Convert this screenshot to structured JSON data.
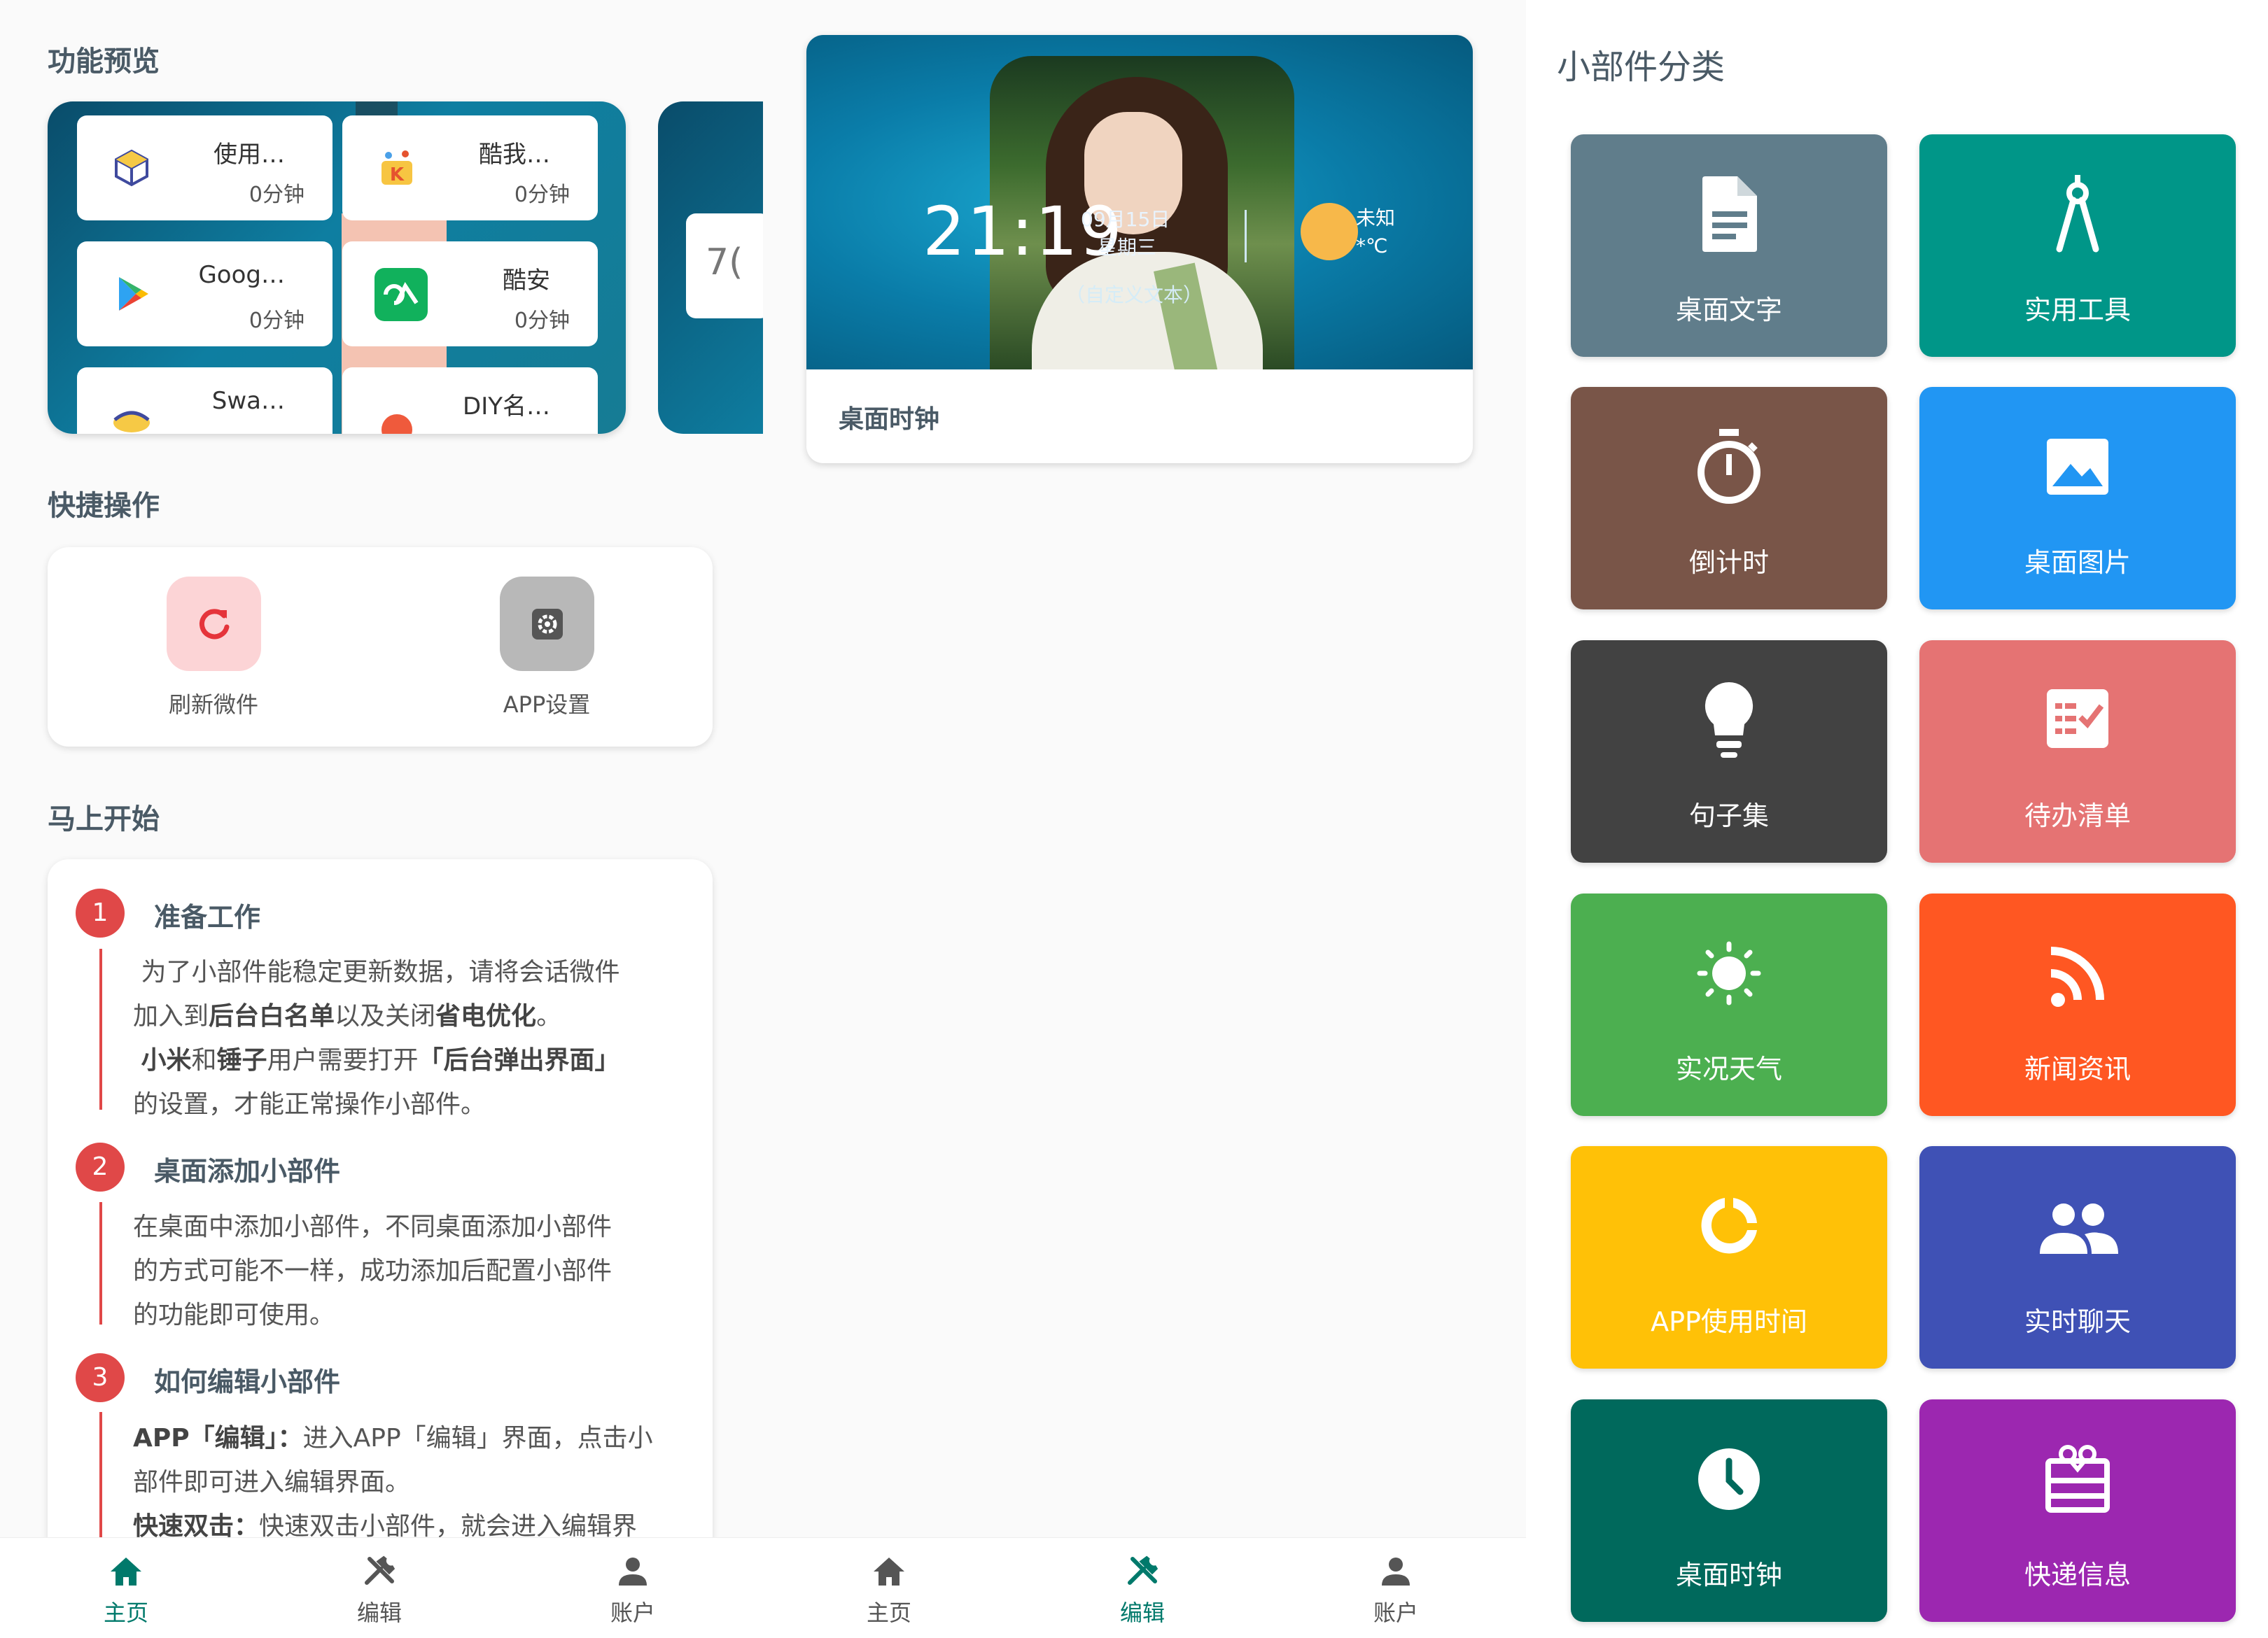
{
  "panel1": {
    "preview_title": "功能预览",
    "preview_tiles": [
      {
        "name": "使用…",
        "time": "0分钟",
        "icon": "cube-icon"
      },
      {
        "name": "酷我…",
        "time": "0分钟",
        "icon": "kuwo-icon"
      },
      {
        "name": "Goog…",
        "time": "0分钟",
        "icon": "google-play-icon"
      },
      {
        "name": "酷安",
        "time": "0分钟",
        "icon": "coolapk-icon"
      },
      {
        "name": "Swa…",
        "time": "",
        "icon": "swap-icon"
      },
      {
        "name": "DIY名…",
        "time": "",
        "icon": "diy-icon"
      }
    ],
    "preview_peek": "7(",
    "quick_title": "快捷操作",
    "quick_actions": [
      {
        "label": "刷新微件",
        "icon": "refresh-icon",
        "color": "#fcd4d6"
      },
      {
        "label": "APP设置",
        "icon": "settings-icon",
        "color": "#b8b8b8"
      }
    ],
    "start_title": "马上开始",
    "steps": [
      {
        "num": "1",
        "title": "准备工作"
      },
      {
        "num": "2",
        "title": "桌面添加小部件"
      },
      {
        "num": "3",
        "title": "如何编辑小部件"
      }
    ],
    "step1_lines": [
      "为了小部件能稳定更新数据，请将会话微件",
      "加入到",
      "后台白名单",
      "以及关闭",
      "省电优化",
      "。",
      "小米",
      "和",
      "锤子",
      "用户需要打开",
      "「后台弹出界面」",
      "的设置，才能正常操作小部件。"
    ],
    "step2_lines": [
      "在桌面中添加小部件，不同桌面添加小部件",
      "的方式可能不一样，成功添加后配置小部件",
      "的功能即可使用。"
    ],
    "step3_lines": [
      "APP「编辑」：",
      "进入APP「编辑」界面，点击小",
      "部件即可进入编辑界面。",
      "快速双击：",
      "快速双击小部件，就会进入编辑界"
    ],
    "nav": [
      {
        "label": "主页",
        "icon": "home-icon",
        "active": true
      },
      {
        "label": "编辑",
        "icon": "tools-icon",
        "active": false
      },
      {
        "label": "账户",
        "icon": "account-icon",
        "active": false
      }
    ]
  },
  "panel2": {
    "clock": {
      "time": "21:19",
      "date": "09月15日",
      "weekday": "星期三",
      "weather_status": "未知",
      "temperature": "*℃",
      "custom_text": "（自定义文本）",
      "label": "桌面时钟"
    },
    "nav": [
      {
        "label": "主页",
        "icon": "home-icon",
        "active": false
      },
      {
        "label": "编辑",
        "icon": "tools-icon",
        "active": true
      },
      {
        "label": "账户",
        "icon": "account-icon",
        "active": false
      }
    ]
  },
  "panel3": {
    "title": "小部件分类",
    "categories": [
      {
        "label": "桌面文字",
        "icon": "document-icon",
        "color": "#607d8b"
      },
      {
        "label": "实用工具",
        "icon": "compass-icon",
        "color": "#009688"
      },
      {
        "label": "倒计时",
        "icon": "timer-icon",
        "color": "#795548"
      },
      {
        "label": "桌面图片",
        "icon": "image-icon",
        "color": "#2196f3"
      },
      {
        "label": "句子集",
        "icon": "lightbulb-icon",
        "color": "#424242"
      },
      {
        "label": "待办清单",
        "icon": "checklist-icon",
        "color": "#e57373"
      },
      {
        "label": "实况天气",
        "icon": "sun-icon",
        "color": "#4caf50"
      },
      {
        "label": "新闻资讯",
        "icon": "rss-icon",
        "color": "#ff5722"
      },
      {
        "label": "APP使用时间",
        "icon": "donut-icon",
        "color": "#ffc107"
      },
      {
        "label": "实时聊天",
        "icon": "people-icon",
        "color": "#3f51b5"
      },
      {
        "label": "桌面时钟",
        "icon": "clock-icon",
        "color": "#00695c"
      },
      {
        "label": "快递信息",
        "icon": "gift-box-icon",
        "color": "#9c27b0"
      }
    ]
  },
  "colors": {
    "accent": "#00796b",
    "inactive": "#555555",
    "step_red": "#e04848"
  }
}
